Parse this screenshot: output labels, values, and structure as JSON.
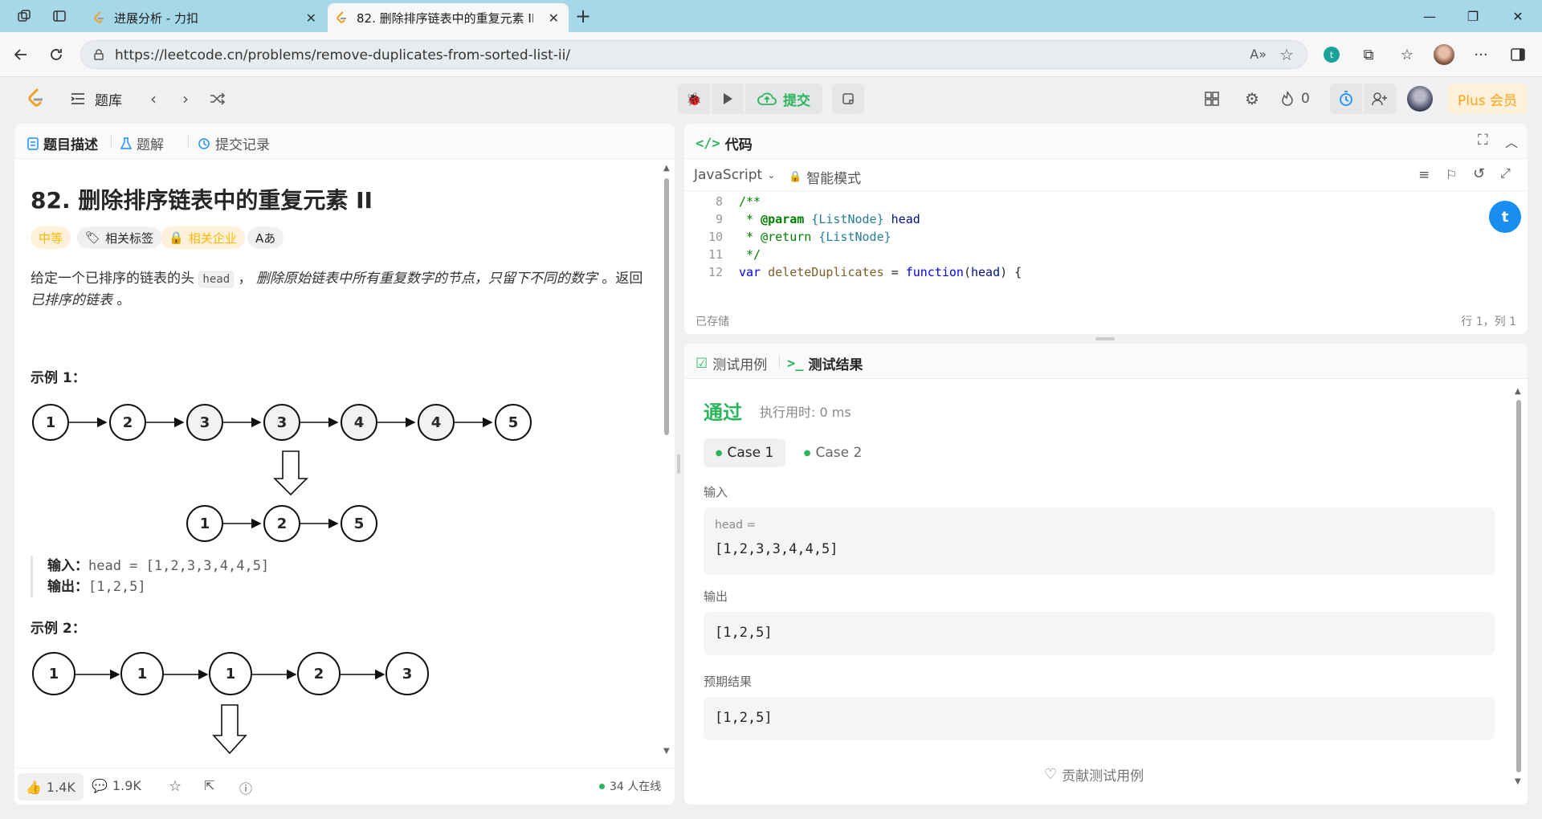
{
  "browser": {
    "tabs": [
      {
        "title": "进展分析 - 力扣",
        "active": false
      },
      {
        "title": "82. 删除排序链表中的重复元素 II",
        "active": true
      }
    ],
    "new_tab": "+",
    "url": "https://leetcode.cn/problems/remove-duplicates-from-sorted-list-ii/"
  },
  "nav": {
    "problem_list": "题库",
    "submit": "提交",
    "fire_count": "0",
    "plus": "Plus 会员"
  },
  "left": {
    "tabs": [
      "题目描述",
      "题解",
      "提交记录"
    ],
    "title": "82. 删除排序链表中的重复元素 II",
    "badges": {
      "difficulty": "中等",
      "tags": "相关标签",
      "companies": "相关企业",
      "lang": "Aあ"
    },
    "desc": {
      "p1": "给定一个已排序的链表的头 ",
      "code": "head",
      "p2": " ， ",
      "em1": "删除原始链表中所有重复数字的节点，只留下不同的数字",
      "p3": " 。返回 ",
      "em2": "已排序的链表",
      "p4": " 。"
    },
    "example1": {
      "label": "示例 1：",
      "nodes_top": [
        "1",
        "2",
        "3",
        "3",
        "4",
        "4",
        "5"
      ],
      "nodes_bottom": [
        "1",
        "2",
        "5"
      ],
      "input_label": "输入：",
      "input": "head = [1,2,3,3,4,4,5]",
      "output_label": "输出：",
      "output": "[1,2,5]"
    },
    "example2": {
      "label": "示例 2：",
      "nodes_top": [
        "1",
        "1",
        "1",
        "2",
        "3"
      ]
    },
    "footer": {
      "likes": "1.4K",
      "comments": "1.9K",
      "online": "34 人在线"
    }
  },
  "code": {
    "header": "代码",
    "language": "JavaScript",
    "mode": "智能模式",
    "lines": [
      {
        "n": "8",
        "t": "/**"
      },
      {
        "n": "9",
        "t": " * @param {ListNode} head"
      },
      {
        "n": "10",
        "t": " * @return {ListNode}"
      },
      {
        "n": "11",
        "t": " */"
      },
      {
        "n": "12",
        "t": "var deleteDuplicates = function(head) {"
      }
    ],
    "saved": "已存储",
    "position": "行 1，列 1"
  },
  "test": {
    "tab_cases": "测试用例",
    "tab_result": "测试结果",
    "status": "通过",
    "runtime": "执行用时: 0 ms",
    "cases": [
      "Case 1",
      "Case 2"
    ],
    "input_label": "输入",
    "input_var": "head =",
    "input_value": "[1,2,3,3,4,4,5]",
    "output_label": "输出",
    "output_value": "[1,2,5]",
    "expected_label": "预期结果",
    "expected_value": "[1,2,5]",
    "contribute": "贡献测试用例"
  },
  "colors": {
    "accent_green": "#2db55d",
    "orange": "#ffa116",
    "browser_tabbar": "#a6d8ea"
  }
}
